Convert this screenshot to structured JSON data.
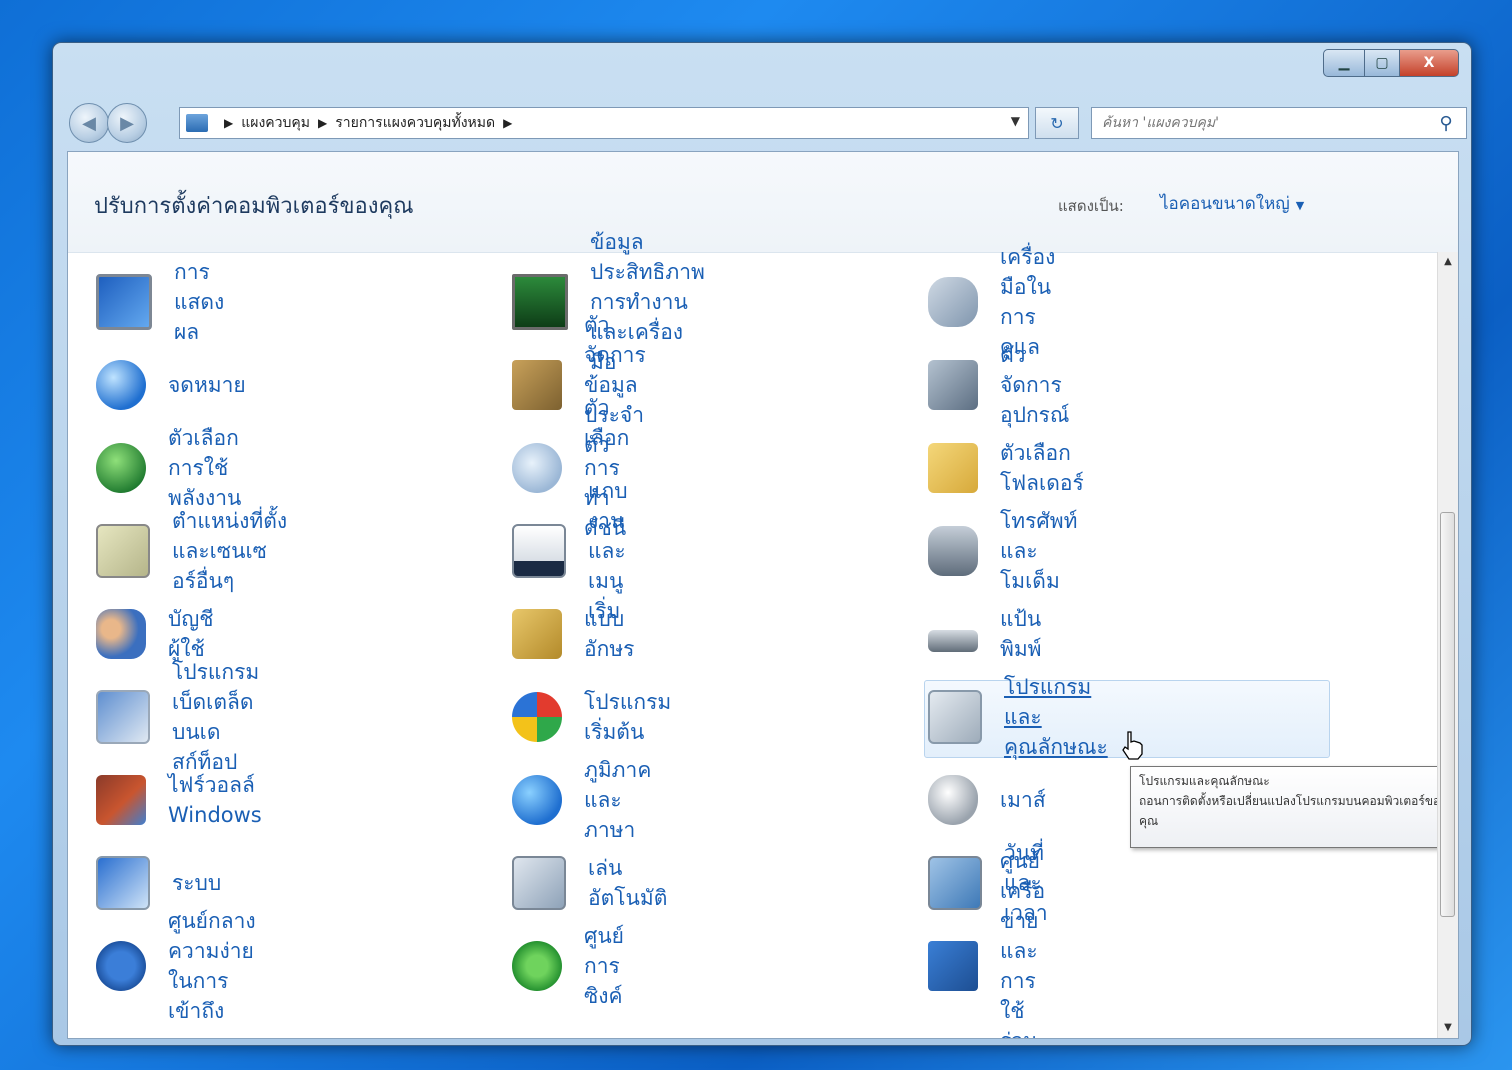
{
  "window": {
    "controls": {
      "minimize": "▁",
      "maximize": "▢",
      "close": "X"
    },
    "nav": {
      "breadcrumb": [
        "แผงควบคุม",
        "รายการแผงควบคุมทั้งหมด"
      ],
      "search_placeholder": "ค้นหา 'แผงควบคุม'"
    }
  },
  "header": {
    "title": "ปรับการตั้งค่าคอมพิวเตอร์ของคุณ",
    "view_by_label": "แสดงเป็น:",
    "view_by_value": "ไอคอนขนาดใหญ่"
  },
  "items": [
    {
      "label": "การแสดงผล",
      "icon": "display-icon"
    },
    {
      "label": "ข้อมูลประสิทธิภาพการทำงานและเครื่องมือ",
      "icon": "performance-icon"
    },
    {
      "label": "เครื่องมือในการดูแล",
      "icon": "admin-tools-icon"
    },
    {
      "label": "จดหมาย",
      "icon": "mail-icon"
    },
    {
      "label": "ตัวจัดการข้อมูลประจำตัว",
      "icon": "credential-manager-icon"
    },
    {
      "label": "ตัวจัดการอุปกรณ์",
      "icon": "device-manager-icon"
    },
    {
      "label": "ตัวเลือกการใช้พลังงาน",
      "icon": "power-icon"
    },
    {
      "label": "ตัวเลือกการทำดัชนี",
      "icon": "indexing-icon"
    },
    {
      "label": "ตัวเลือกโฟลเดอร์",
      "icon": "folder-options-icon"
    },
    {
      "label": "ตำแหน่งที่ตั้งและเซนเซอร์อื่นๆ",
      "icon": "location-sensor-icon"
    },
    {
      "label": "แถบงานและเมนูเริ่ม",
      "icon": "taskbar-icon"
    },
    {
      "label": "โทรศัพท์และโมเด็ม",
      "icon": "phone-modem-icon"
    },
    {
      "label": "บัญชีผู้ใช้",
      "icon": "user-accounts-icon"
    },
    {
      "label": "แบบอักษร",
      "icon": "fonts-icon"
    },
    {
      "label": "แป้นพิมพ์",
      "icon": "keyboard-icon"
    },
    {
      "label": "โปรแกรมเบ็ดเตล็ดบนเดสก์ท็อป",
      "icon": "desktop-gadgets-icon"
    },
    {
      "label": "โปรแกรมเริ่มต้น",
      "icon": "default-programs-icon"
    },
    {
      "label": "โปรแกรมและคุณลักษณะ",
      "icon": "programs-features-icon"
    },
    {
      "label": "ไฟร์วอลล์ Windows",
      "icon": "firewall-icon"
    },
    {
      "label": "ภูมิภาคและภาษา",
      "icon": "region-language-icon"
    },
    {
      "label": "เมาส์",
      "icon": "mouse-icon"
    },
    {
      "label": "ระบบ",
      "icon": "system-icon"
    },
    {
      "label": "เล่นอัตโนมัติ",
      "icon": "autoplay-icon"
    },
    {
      "label": "วันที่และเวลา",
      "icon": "date-time-icon"
    },
    {
      "label": "ศูนย์กลางความง่ายในการเข้าถึง",
      "icon": "ease-of-access-icon"
    },
    {
      "label": "ศูนย์การซิงค์",
      "icon": "sync-center-icon"
    },
    {
      "label": "ศูนย์เครือข่ายและการใช้ร่วมกัน",
      "icon": "network-sharing-icon"
    }
  ],
  "tooltip": {
    "title": "โปรแกรมและคุณลักษณะ",
    "body": "ถอนการติดตั้งหรือเปลี่ยนแปลงโปรแกรมบนคอมพิวเตอร์ของคุณ"
  }
}
